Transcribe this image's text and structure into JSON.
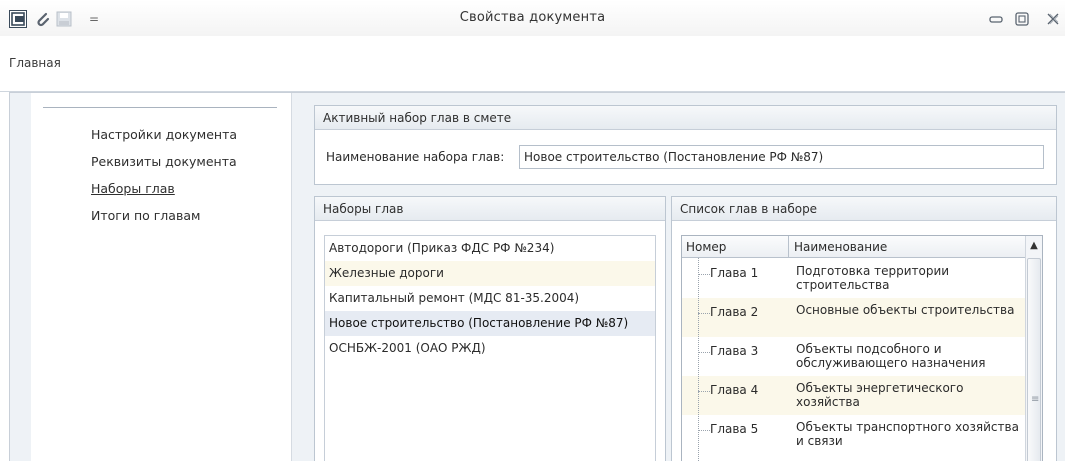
{
  "window": {
    "title": "Свойства документа",
    "icons": [
      "app-logo-icon",
      "paperclip-icon",
      "save-icon",
      "quick-access-menu-icon"
    ],
    "controls": [
      "minimize-icon",
      "restore-icon",
      "close-icon"
    ],
    "quick_access_menu_glyph": "="
  },
  "ribbon": {
    "tab": "Главная"
  },
  "sidebar": {
    "items": [
      {
        "label": "Настройки документа",
        "active": false
      },
      {
        "label": "Реквизиты документа",
        "active": false
      },
      {
        "label": "Наборы глав",
        "active": true
      },
      {
        "label": "Итоги по главам",
        "active": false
      }
    ]
  },
  "active_set": {
    "header": "Активный набор глав в смете",
    "label": "Наименование набора глав:",
    "value": "Новое строительство (Постановление РФ №87)"
  },
  "sets": {
    "header": "Наборы глав",
    "items": [
      "Автодороги (Приказ ФДС РФ №234)",
      "Железные дороги",
      "Капитальный ремонт (МДС 81-35.2004)",
      "Новое строительство (Постановление РФ №87)",
      "ОСНБЖ-2001 (ОАО РЖД)"
    ],
    "selected_index": 3
  },
  "chapters": {
    "header": "Список глав в наборе",
    "columns": [
      "Номер",
      "Наименование"
    ],
    "rows": [
      {
        "number": "Глава 1",
        "name": "Подготовка территории строительства"
      },
      {
        "number": "Глава 2",
        "name": "Основные объекты строительства"
      },
      {
        "number": "Глава 3",
        "name": "Объекты подсобного и обслуживающего назначения"
      },
      {
        "number": "Глава 4",
        "name": "Объекты энергетического хозяйства"
      },
      {
        "number": "Глава 5",
        "name": "Объекты транспортного хозяйства и связи"
      }
    ],
    "scroll_up_glyph": "▲",
    "scroll_grip_glyph": "≡"
  }
}
